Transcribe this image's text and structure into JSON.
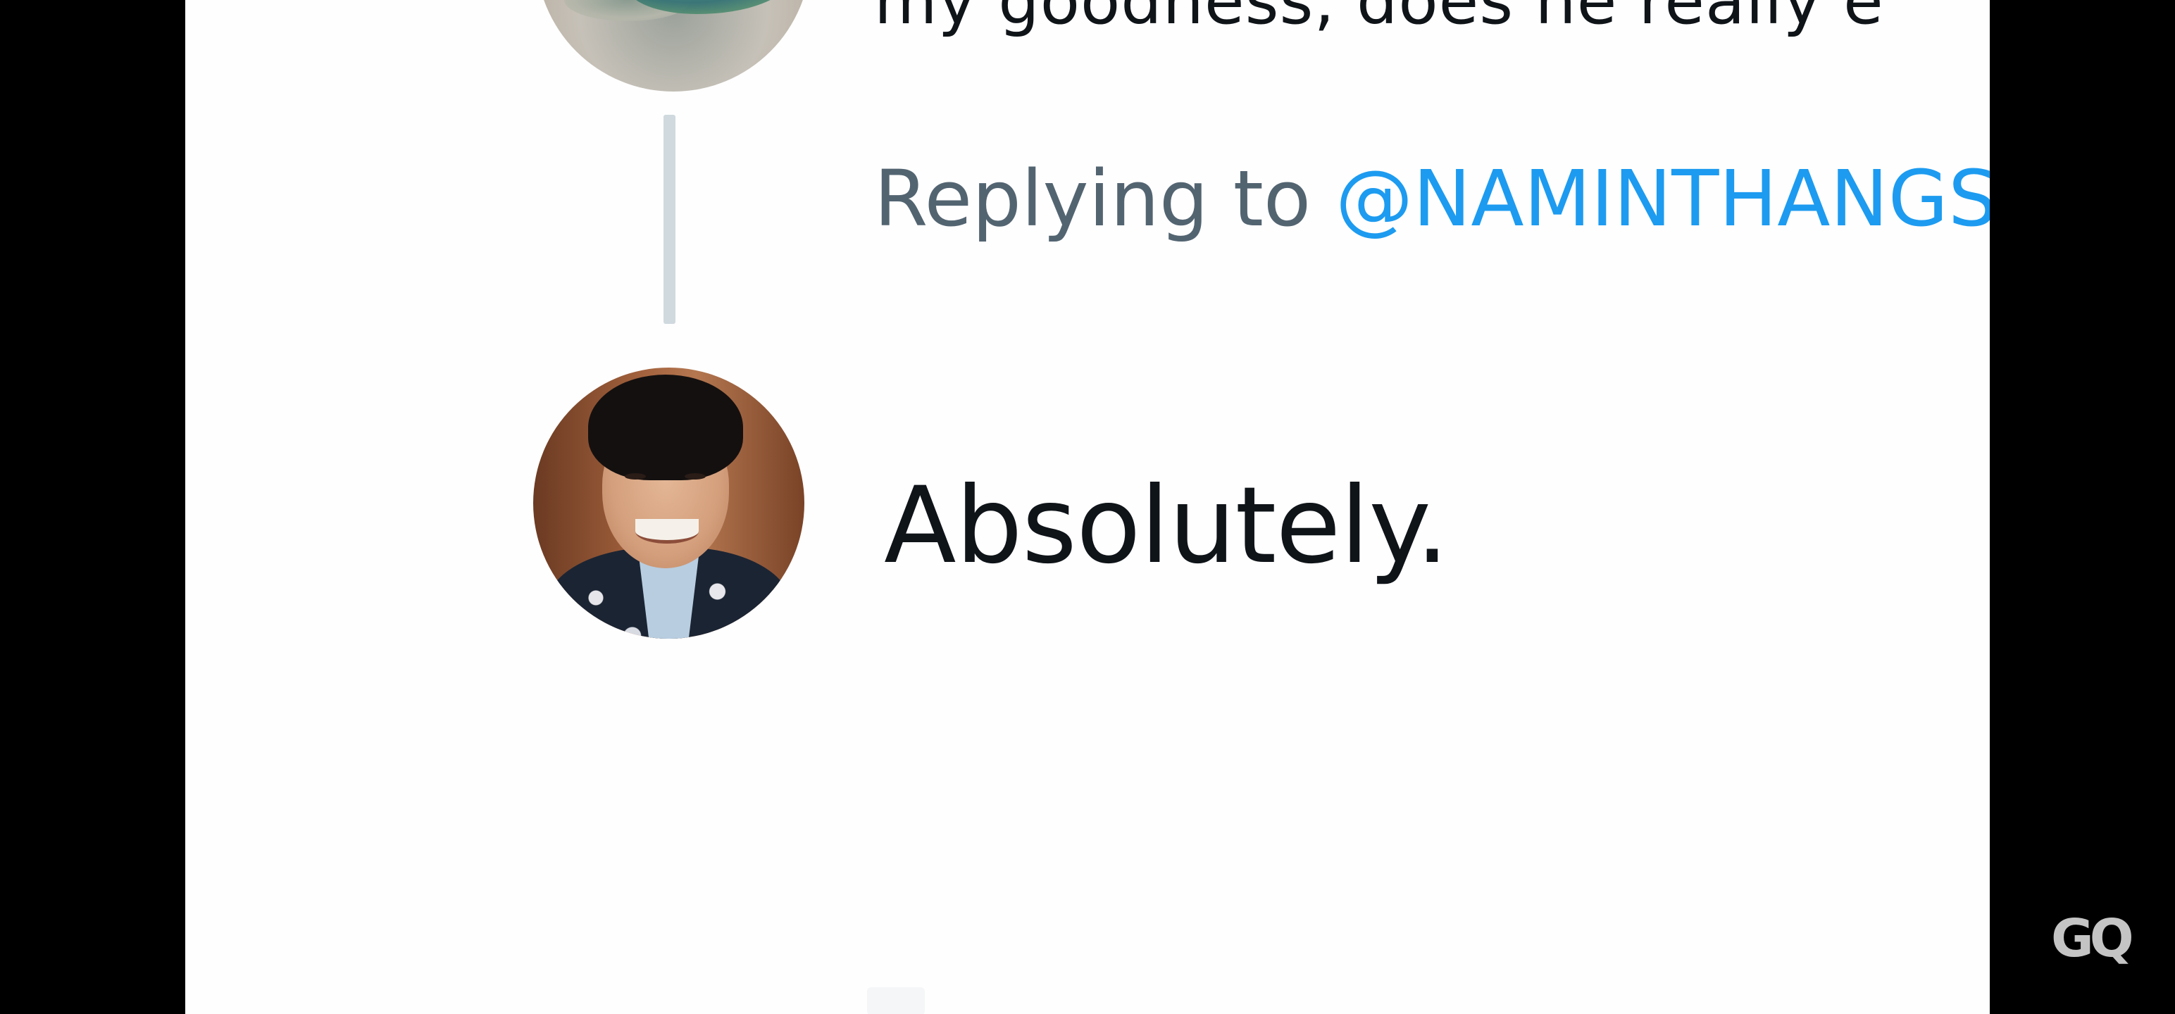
{
  "previous_tweet": {
    "text": "my goodness, does he really e",
    "replying_prefix": "Replying to ",
    "replying_handle": "@NAMINTHANGS"
  },
  "reply_tweet": {
    "text": "Absolutely."
  },
  "watermark": {
    "text": "GQ"
  },
  "colors": {
    "mention": "#1d9bf0",
    "muted_text": "#536471",
    "body_text": "#0f1419",
    "thread_line": "#cfd9de"
  }
}
